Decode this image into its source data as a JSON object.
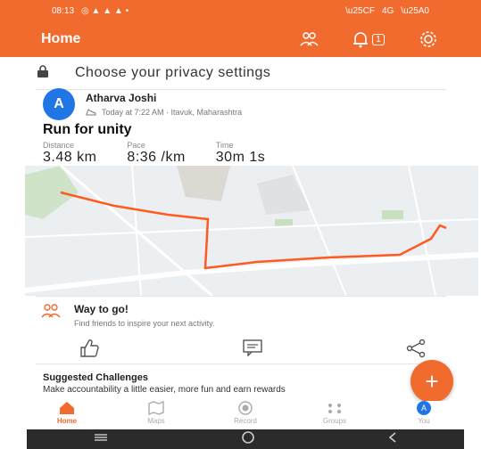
{
  "status_bar": {
    "time": "08:13",
    "indicators": "◎ ▲ ▲ ▲ •",
    "right": "4G"
  },
  "app_bar": {
    "title": "Home",
    "icons": [
      "people-icon",
      "bell-icon",
      "notification-badge-icon",
      "gear-icon"
    ],
    "notification_count": "1"
  },
  "privacy": {
    "text": "Choose your privacy settings"
  },
  "activity": {
    "athlete_initial": "A",
    "athlete_name": "Atharva Joshi",
    "meta": "Today at 7:22 AM · Itavuk, Maharashtra",
    "title": "Run for unity",
    "stats": [
      {
        "label": "Distance",
        "value": "3.48 km"
      },
      {
        "label": "Pace",
        "value": "8:36 /km"
      },
      {
        "label": "Time",
        "value": "30m 1s"
      }
    ]
  },
  "kudos": {
    "title": "Way to go!",
    "subtitle": "Find friends to inspire your next activity."
  },
  "challenges": {
    "title": "Suggested Challenges",
    "subtitle": "Make accountability a little easier, more fun and earn rewards"
  },
  "fab": {
    "label": "+"
  },
  "bottom_nav": [
    {
      "label": "Home",
      "active": true
    },
    {
      "label": "Maps",
      "active": false
    },
    {
      "label": "Record",
      "active": false
    },
    {
      "label": "Groups",
      "active": false
    },
    {
      "label": "You",
      "active": false
    }
  ],
  "you_initial": "A",
  "colors": {
    "accent": "#f26b2e",
    "avatar": "#2176e6",
    "route": "#ff5a1f"
  }
}
